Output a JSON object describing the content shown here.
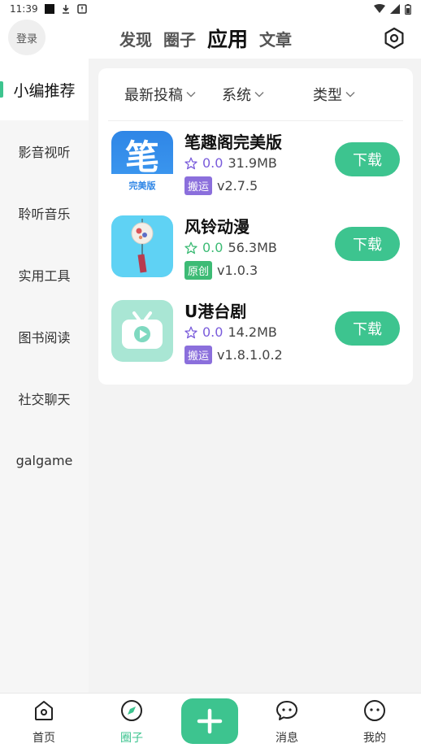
{
  "status": {
    "time": "11:39"
  },
  "header": {
    "login": "登录",
    "tabs": [
      {
        "label": "发现"
      },
      {
        "label": "圈子"
      },
      {
        "label": "应用"
      },
      {
        "label": "文章"
      }
    ],
    "active_tab": "应用"
  },
  "sidebar": {
    "items": [
      {
        "label": "小编推荐"
      },
      {
        "label": "影音视听"
      },
      {
        "label": "聆听音乐"
      },
      {
        "label": "实用工具"
      },
      {
        "label": "图书阅读"
      },
      {
        "label": "社交聊天"
      },
      {
        "label": "galgame"
      }
    ],
    "active": "小编推荐"
  },
  "filters": [
    {
      "label": "最新投稿"
    },
    {
      "label": "系统"
    },
    {
      "label": "类型"
    }
  ],
  "apps": [
    {
      "name": "笔趣阁完美版",
      "rating": "0.0",
      "size": "31.9MB",
      "tag": "搬运",
      "version": "v2.7.5",
      "icon_text": "笔",
      "icon_sub": "完美版"
    },
    {
      "name": "风铃动漫",
      "rating": "0.0",
      "size": "56.3MB",
      "tag": "原创",
      "version": "v1.0.3"
    },
    {
      "name": "U港台剧",
      "rating": "0.0",
      "size": "14.2MB",
      "tag": "搬运",
      "version": "v1.8.1.0.2"
    }
  ],
  "download_label": "下载",
  "tabbar": {
    "items": [
      {
        "label": "首页",
        "icon": "home-icon"
      },
      {
        "label": "圈子",
        "icon": "compass-icon"
      },
      {
        "label": "消息",
        "icon": "message-icon"
      },
      {
        "label": "我的",
        "icon": "profile-icon"
      }
    ],
    "active": "圈子"
  },
  "colors": {
    "accent": "#3dc48f",
    "tag_repost": "#8b6fdc",
    "tag_original": "#3dbb75",
    "rating": "#7a5cdb"
  }
}
